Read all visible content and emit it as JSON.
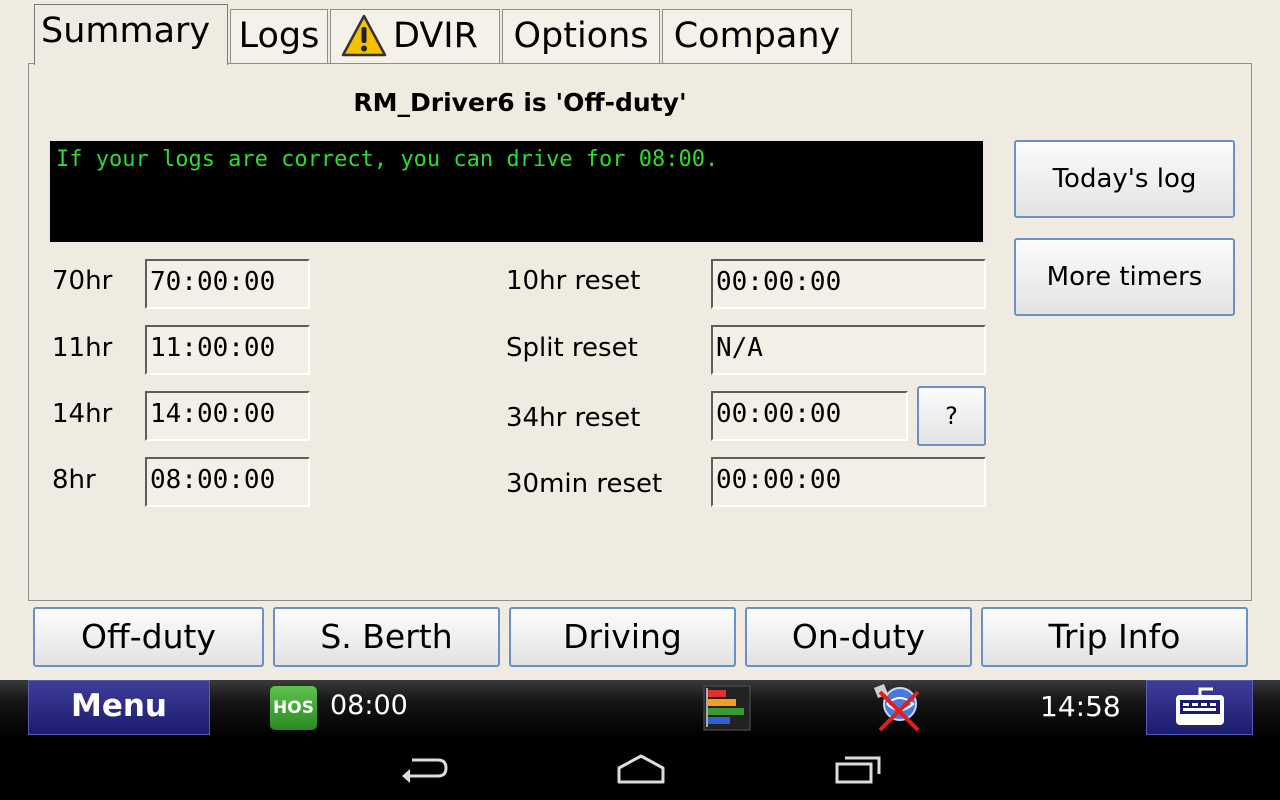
{
  "tabs": [
    {
      "label": "Summary"
    },
    {
      "label": "Logs"
    },
    {
      "label": "DVIR",
      "icon": "warning-icon"
    },
    {
      "label": "Options"
    },
    {
      "label": "Company"
    }
  ],
  "status_title": "RM_Driver6 is 'Off-duty'",
  "message": "If your logs are correct, you can drive for 08:00.",
  "timers_left": [
    {
      "label": "70hr",
      "value": "70:00:00"
    },
    {
      "label": "11hr",
      "value": "11:00:00"
    },
    {
      "label": "14hr",
      "value": "14:00:00"
    },
    {
      "label": "8hr",
      "value": "08:00:00"
    }
  ],
  "timers_right": [
    {
      "label": "10hr reset",
      "value": "00:00:00"
    },
    {
      "label": "Split reset",
      "value": "N/A"
    },
    {
      "label": "34hr reset",
      "value": "00:00:00"
    },
    {
      "label": "30min reset",
      "value": "00:00:00"
    }
  ],
  "help_label": "?",
  "side_buttons": {
    "todays_log": "Today's log",
    "more_timers": "More timers"
  },
  "duty_buttons": [
    "Off-duty",
    "S. Berth",
    "Driving",
    "On-duty",
    "Trip Info"
  ],
  "statusbar": {
    "menu_label": "Menu",
    "hos_badge": "HOS",
    "hos_time": "08:00",
    "clock": "14:58"
  },
  "colors": {
    "message_text": "#2edb2e",
    "menu_blue": "#1b1b6e",
    "button_border": "#6b8fc7"
  }
}
